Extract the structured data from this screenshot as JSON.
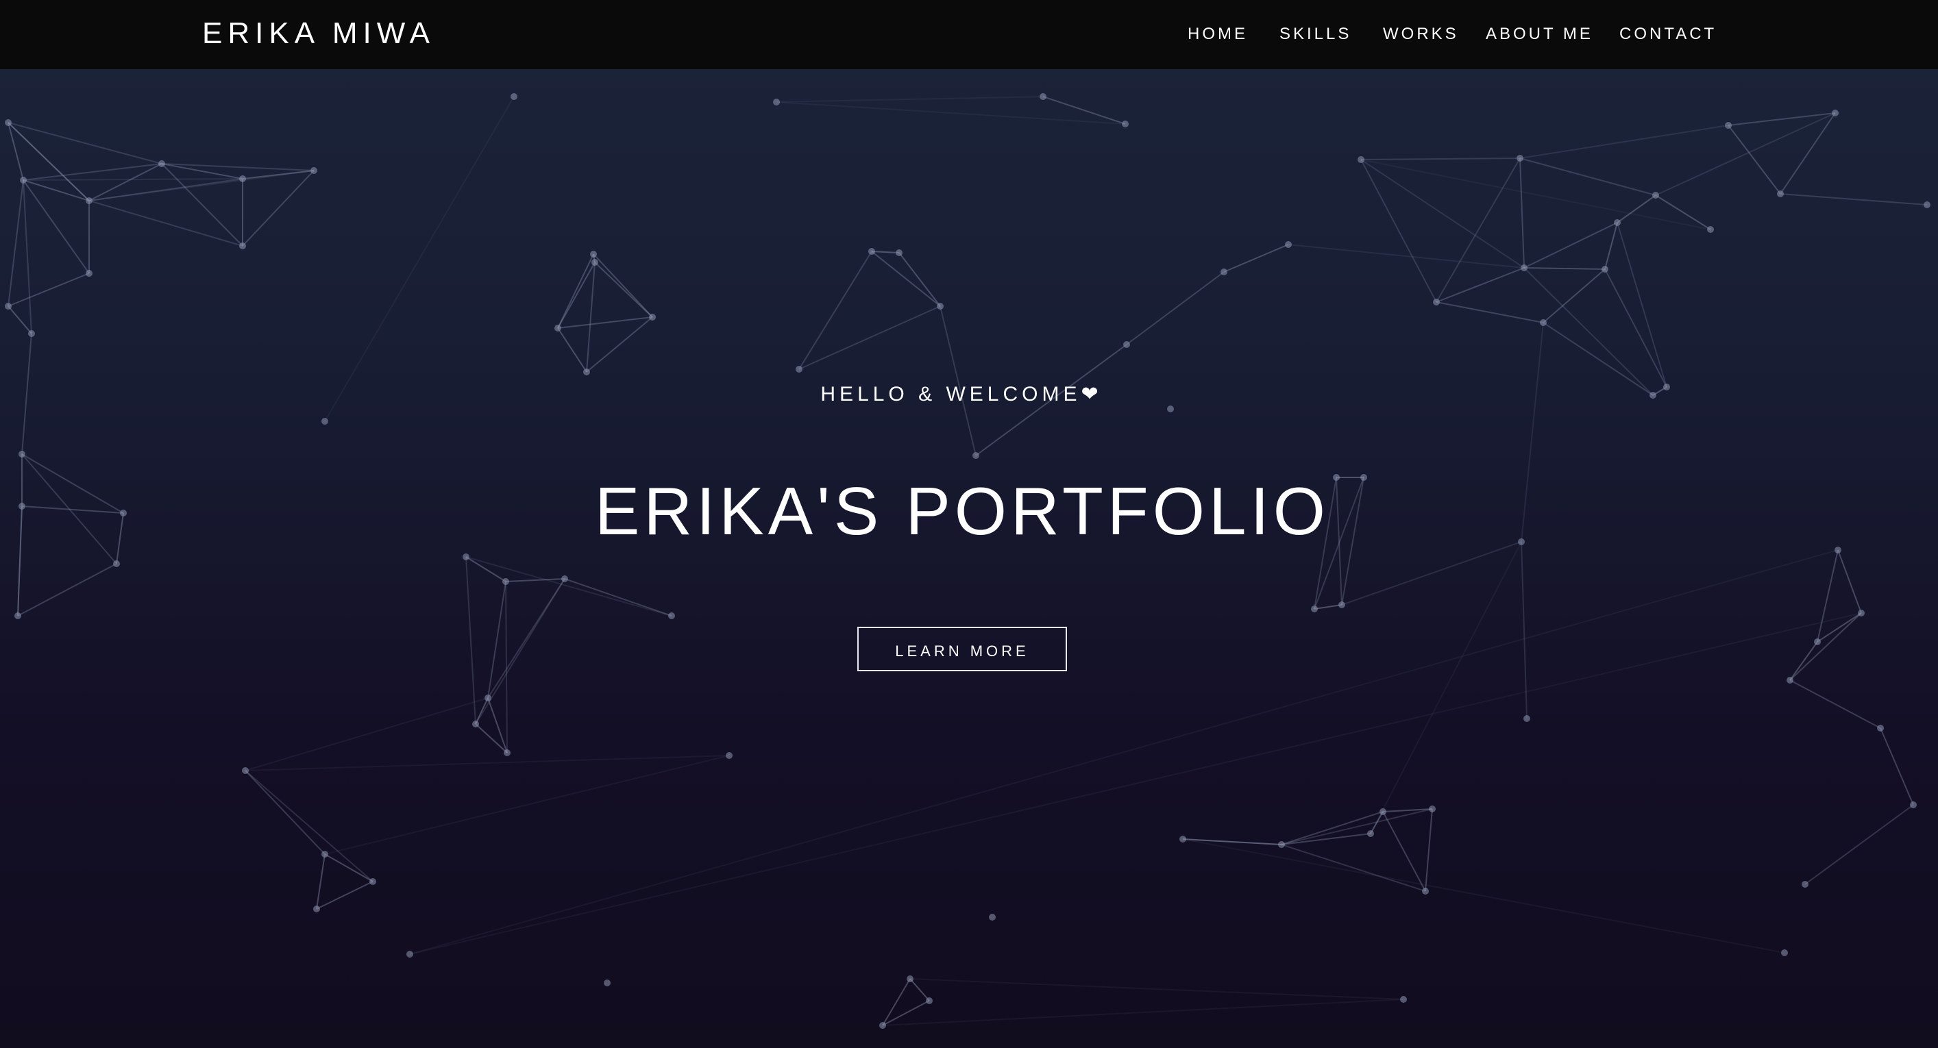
{
  "navbar": {
    "brand": "ERIKA MIWA",
    "items": [
      {
        "label": "HOME"
      },
      {
        "label": "SKILLS"
      },
      {
        "label": "WORKS"
      },
      {
        "label": "ABOUT ME"
      },
      {
        "label": "CONTACT"
      }
    ]
  },
  "hero": {
    "greeting": "HELLO & WELCOME",
    "greeting_icon": "heart-icon",
    "heart_glyph": "❤",
    "title": "ERIKA'S PORTFOLIO",
    "button_label": "LEARN MORE"
  },
  "colors": {
    "navbar_bg": "#0a0a0a",
    "hero_top": "#1b2339",
    "hero_bottom": "#110c1e",
    "text": "#ffffff",
    "network_lines": "#8f97b3"
  }
}
